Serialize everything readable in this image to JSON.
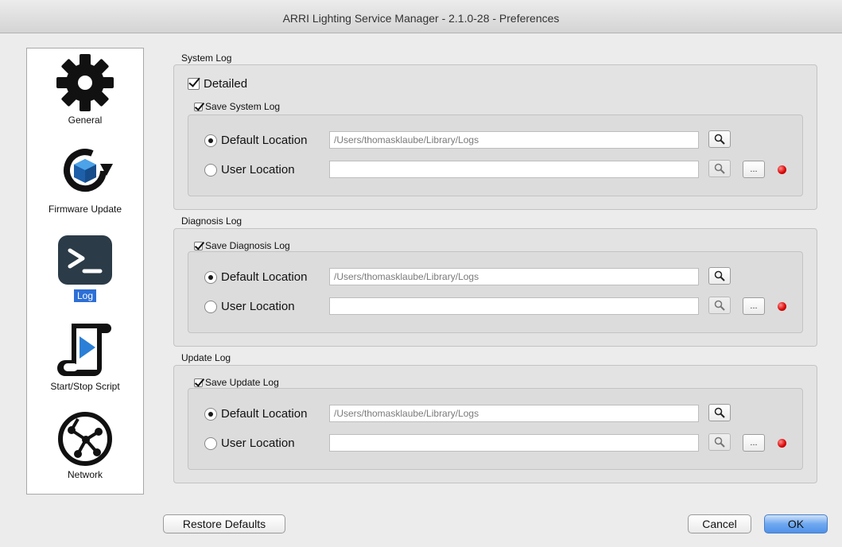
{
  "window": {
    "title": "ARRI Lighting Service Manager - 2.1.0-28 - Preferences"
  },
  "sidebar": {
    "items": [
      {
        "label": "General",
        "icon": "gear-icon"
      },
      {
        "label": "Firmware Update",
        "icon": "firmware-update-icon"
      },
      {
        "label": "Log",
        "icon": "terminal-icon",
        "selected": true
      },
      {
        "label": "Start/Stop Script",
        "icon": "script-play-icon"
      },
      {
        "label": "Network",
        "icon": "network-icon"
      }
    ]
  },
  "system_log": {
    "title": "System Log",
    "detailed_label": "Detailed",
    "detailed_checked": true,
    "save_label": "Save System Log",
    "save_checked": true,
    "default_location_label": "Default Location",
    "default_location_value": "/Users/thomasklaube/Library/Logs",
    "user_location_label": "User Location",
    "user_location_value": "",
    "selected": "default",
    "browse_label": "..."
  },
  "diagnosis_log": {
    "title": "Diagnosis Log",
    "save_label": "Save Diagnosis Log",
    "save_checked": true,
    "default_location_label": "Default Location",
    "default_location_value": "/Users/thomasklaube/Library/Logs",
    "user_location_label": "User Location",
    "user_location_value": "",
    "selected": "default",
    "browse_label": "..."
  },
  "update_log": {
    "title": "Update Log",
    "save_label": "Save Update Log",
    "save_checked": true,
    "default_location_label": "Default Location",
    "default_location_value": "/Users/thomasklaube/Library/Logs",
    "user_location_label": "User Location",
    "user_location_value": "",
    "selected": "default",
    "browse_label": "..."
  },
  "footer": {
    "restore_label": "Restore Defaults",
    "cancel_label": "Cancel",
    "ok_label": "OK"
  },
  "colors": {
    "selection": "#2d6fd6",
    "status_led": "#d80000",
    "primary_button": "#5b9bec"
  }
}
